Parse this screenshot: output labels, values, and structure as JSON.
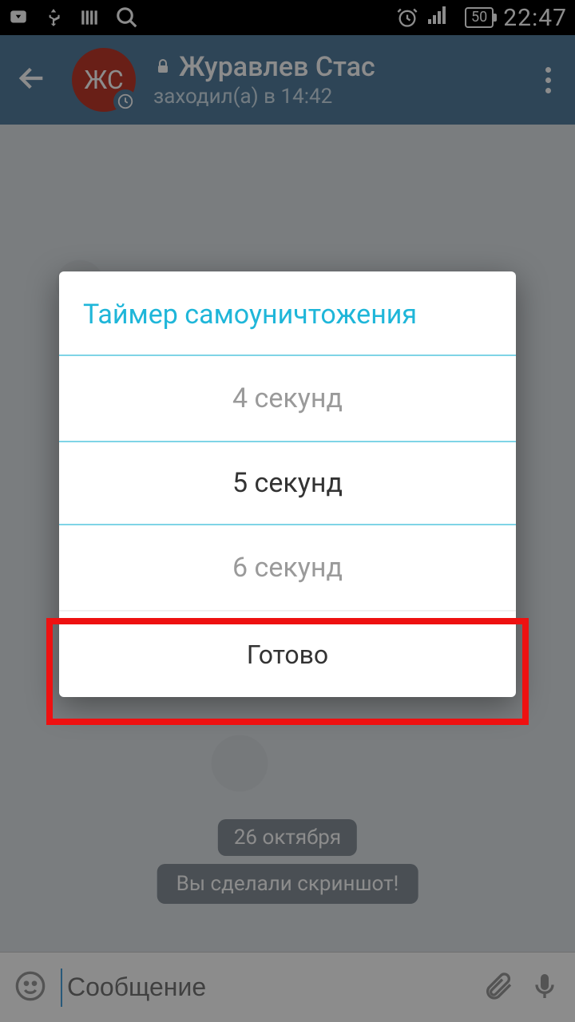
{
  "status": {
    "time": "22:47",
    "battery": "50"
  },
  "header": {
    "avatar_initials": "ЖС",
    "contact_name": "Журавлев Стас",
    "last_seen": "заходил(а) в 14:42"
  },
  "chat": {
    "date_chip": "26 октября",
    "info_chip": "Вы сделали скриншот!"
  },
  "input": {
    "placeholder": "Сообщение"
  },
  "dialog": {
    "title": "Таймер самоуничтожения",
    "options": {
      "prev": "4 секунд",
      "selected": "5 секунд",
      "next": "6 секунд"
    },
    "done_label": "Готово"
  }
}
